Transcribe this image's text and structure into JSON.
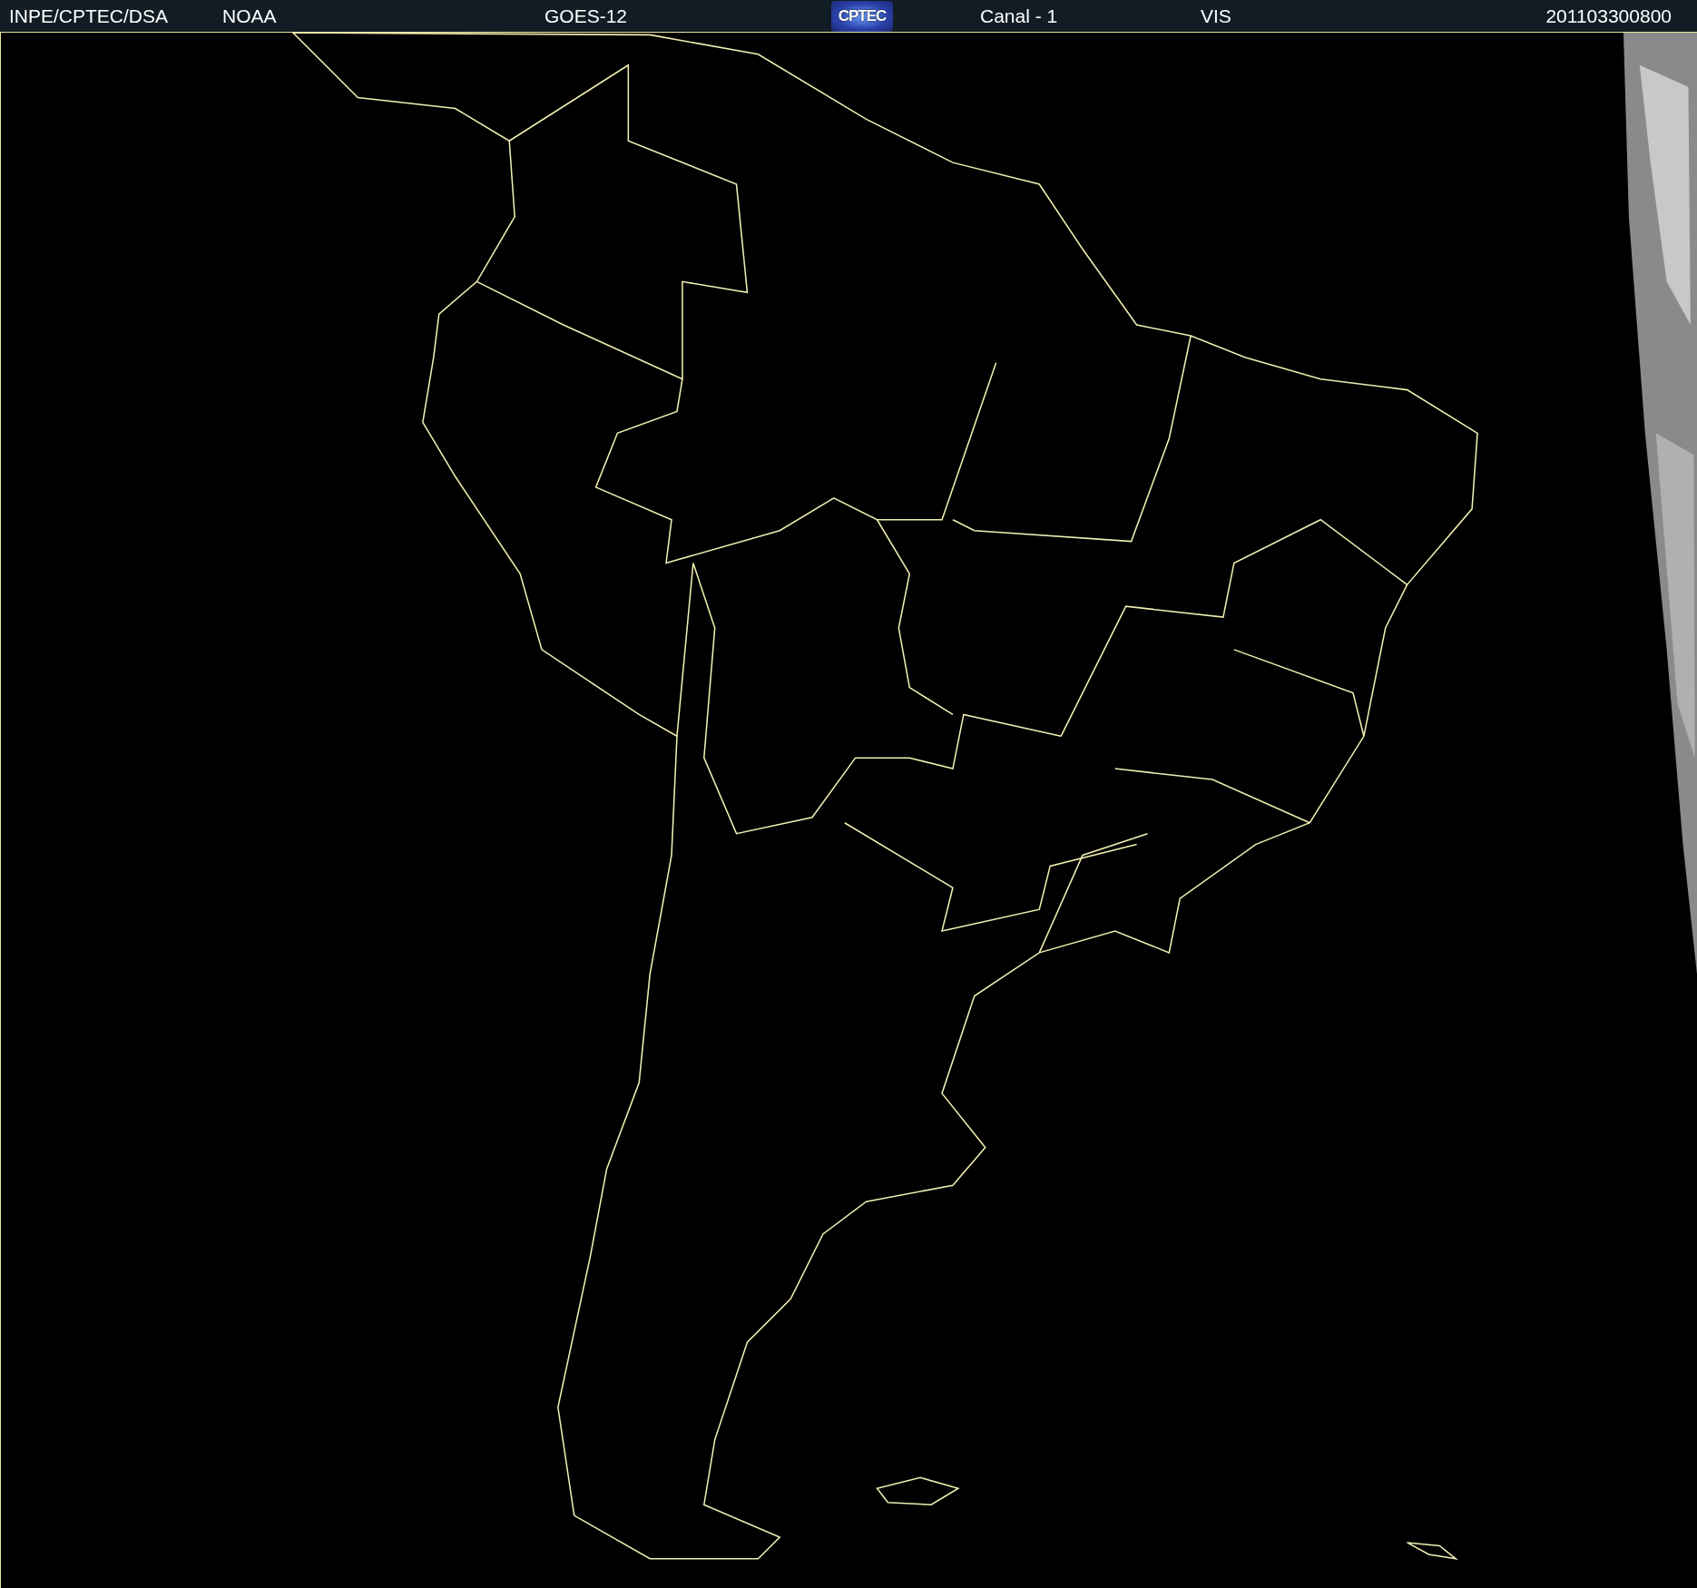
{
  "header": {
    "items": [
      {
        "kind": "text",
        "label": "INPE/CPTEC/DSA"
      },
      {
        "kind": "text",
        "label": "NOAA"
      },
      {
        "kind": "text",
        "label": "GOES-12"
      },
      {
        "kind": "logo",
        "label": "CPTEC"
      },
      {
        "kind": "text",
        "label": "Canal - 1"
      },
      {
        "kind": "text",
        "label": "VIS"
      },
      {
        "kind": "text",
        "label": "201103300800"
      }
    ]
  }
}
